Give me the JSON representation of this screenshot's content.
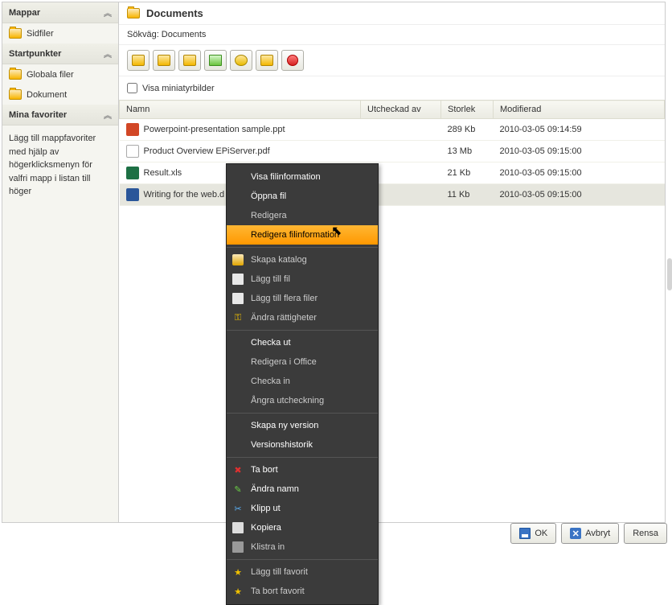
{
  "sidebar": {
    "sections": {
      "folders": {
        "header": "Mappar",
        "items": [
          {
            "label": "Sidfiler"
          }
        ]
      },
      "starting": {
        "header": "Startpunkter",
        "items": [
          {
            "label": "Globala filer"
          },
          {
            "label": "Dokument"
          }
        ]
      },
      "favorites": {
        "header": "Mina favoriter",
        "help": "Lägg till mappfavoriter med hjälp av högerklicksmenyn för valfri mapp i listan till höger"
      }
    }
  },
  "content": {
    "title": "Documents",
    "path_label": "Sökväg: Documents",
    "thumbs_label": "Visa miniatyrbilder",
    "columns": {
      "name": "Namn",
      "checked": "Utcheckad av",
      "size": "Storlek",
      "modified": "Modifierad"
    },
    "rows": [
      {
        "name": "Powerpoint-presentation sample.ppt",
        "type": "ppt",
        "checked": "",
        "size": "289 Kb",
        "modified": "2010-03-05 09:14:59"
      },
      {
        "name": "Product Overview EPiServer.pdf",
        "type": "pdf",
        "checked": "",
        "size": "13 Mb",
        "modified": "2010-03-05 09:15:00"
      },
      {
        "name": "Result.xls",
        "type": "xls",
        "checked": "",
        "size": "21 Kb",
        "modified": "2010-03-05 09:15:00"
      },
      {
        "name": "Writing for the web.doc",
        "type": "doc",
        "checked": "",
        "size": "11 Kb",
        "modified": "2010-03-05 09:15:00"
      }
    ]
  },
  "context_menu": {
    "items": [
      {
        "label": "Visa filinformation",
        "enabled": true
      },
      {
        "label": "Öppna fil",
        "enabled": true
      },
      {
        "label": "Redigera",
        "enabled": false
      },
      {
        "label": "Redigera filinformation",
        "enabled": true,
        "highlight": true
      },
      {
        "sep": true
      },
      {
        "label": "Skapa katalog",
        "enabled": false,
        "icon": "folder"
      },
      {
        "label": "Lägg till fil",
        "enabled": false,
        "icon": "page"
      },
      {
        "label": "Lägg till flera filer",
        "enabled": false,
        "icon": "page"
      },
      {
        "label": "Ändra rättigheter",
        "enabled": false,
        "icon": "key"
      },
      {
        "sep": true
      },
      {
        "label": "Checka ut",
        "enabled": true
      },
      {
        "label": "Redigera i Office",
        "enabled": false
      },
      {
        "label": "Checka in",
        "enabled": false
      },
      {
        "label": "Ångra utcheckning",
        "enabled": false
      },
      {
        "sep": true
      },
      {
        "label": "Skapa ny version",
        "enabled": true
      },
      {
        "label": "Versionshistorik",
        "enabled": true
      },
      {
        "sep": true
      },
      {
        "label": "Ta bort",
        "enabled": true,
        "icon": "del"
      },
      {
        "label": "Ändra namn",
        "enabled": true,
        "icon": "pencil"
      },
      {
        "label": "Klipp ut",
        "enabled": true,
        "icon": "scissors"
      },
      {
        "label": "Kopiera",
        "enabled": true,
        "icon": "copy"
      },
      {
        "label": "Klistra in",
        "enabled": false,
        "icon": "paste"
      },
      {
        "sep": true
      },
      {
        "label": "Lägg till favorit",
        "enabled": false,
        "icon": "star"
      },
      {
        "label": "Ta bort favorit",
        "enabled": false,
        "icon": "star"
      }
    ]
  },
  "buttons": {
    "ok": "OK",
    "cancel": "Avbryt",
    "clear": "Rensa"
  }
}
